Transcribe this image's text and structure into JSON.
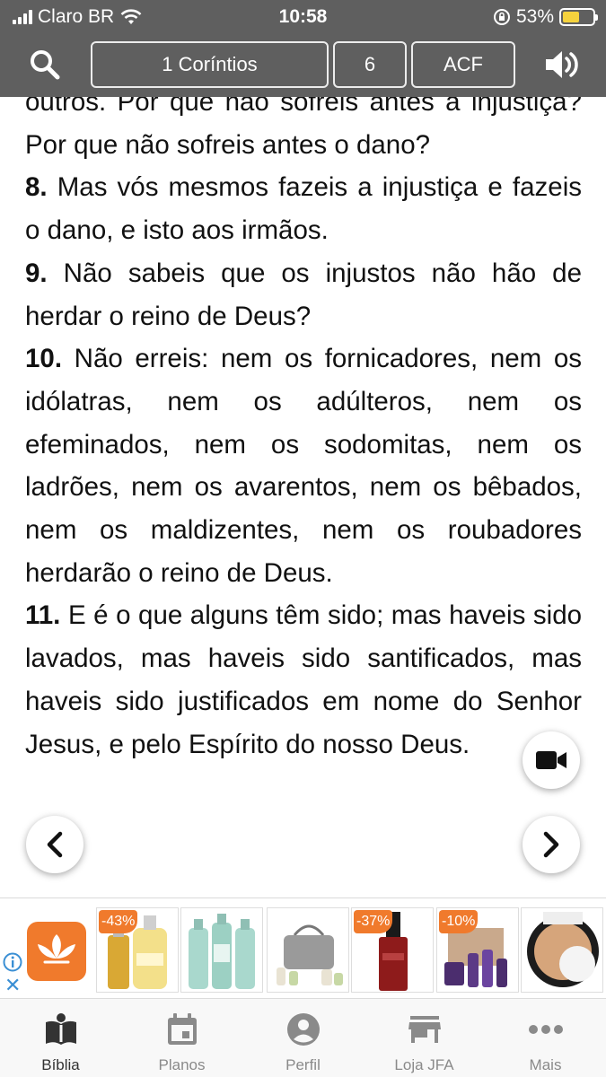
{
  "status_bar": {
    "carrier": "Claro BR",
    "time": "10:58",
    "battery": "53%"
  },
  "header": {
    "book": "1 Coríntios",
    "chapter": "6",
    "version": "ACF"
  },
  "verses": [
    {
      "number": "",
      "text": "outros. Por que não sofreis antes a injustiça? Por que não sofreis antes o dano?"
    },
    {
      "number": "8.",
      "text": "Mas vós mesmos fazeis a injustiça e fazeis o dano, e isto aos irmãos."
    },
    {
      "number": "9.",
      "text": "Não sabeis que os injustos não hão de herdar o reino de Deus?"
    },
    {
      "number": "10.",
      "text": "Não erreis: nem os fornicadores, nem os idólatras, nem os adúlteros, nem os efeminados, nem os sodomitas, nem os ladrões, nem os avarentos, nem os bêbados, nem os maldizentes, nem os roubadores herdarão o reino de Deus."
    },
    {
      "number": "11.",
      "text": "E é o que alguns têm sido; mas haveis sido lavados, mas haveis sido santificados, mas haveis sido justificados em nome do Senhor Jesus, e pelo Espírito do nosso Deus."
    }
  ],
  "ad": {
    "products": [
      {
        "badge": "-43%",
        "label": ""
      },
      {
        "badge": "",
        "label": ""
      },
      {
        "badge": "",
        "label": ""
      },
      {
        "badge": "-37%",
        "label": ""
      },
      {
        "badge": "-10%",
        "label": ""
      },
      {
        "badge": "",
        "label": ""
      }
    ],
    "colors": {
      "brand": "#f07a2c"
    }
  },
  "tabs": [
    {
      "label": "Bíblia",
      "icon": "bible-icon",
      "active": true
    },
    {
      "label": "Planos",
      "icon": "calendar-icon",
      "active": false
    },
    {
      "label": "Perfil",
      "icon": "profile-icon",
      "active": false
    },
    {
      "label": "Loja JFA",
      "icon": "store-icon",
      "active": false
    },
    {
      "label": "Mais",
      "icon": "more-icon",
      "active": false
    }
  ],
  "colors": {
    "header_bg": "#5f5f5f",
    "battery_fill": "#f5d23d"
  }
}
